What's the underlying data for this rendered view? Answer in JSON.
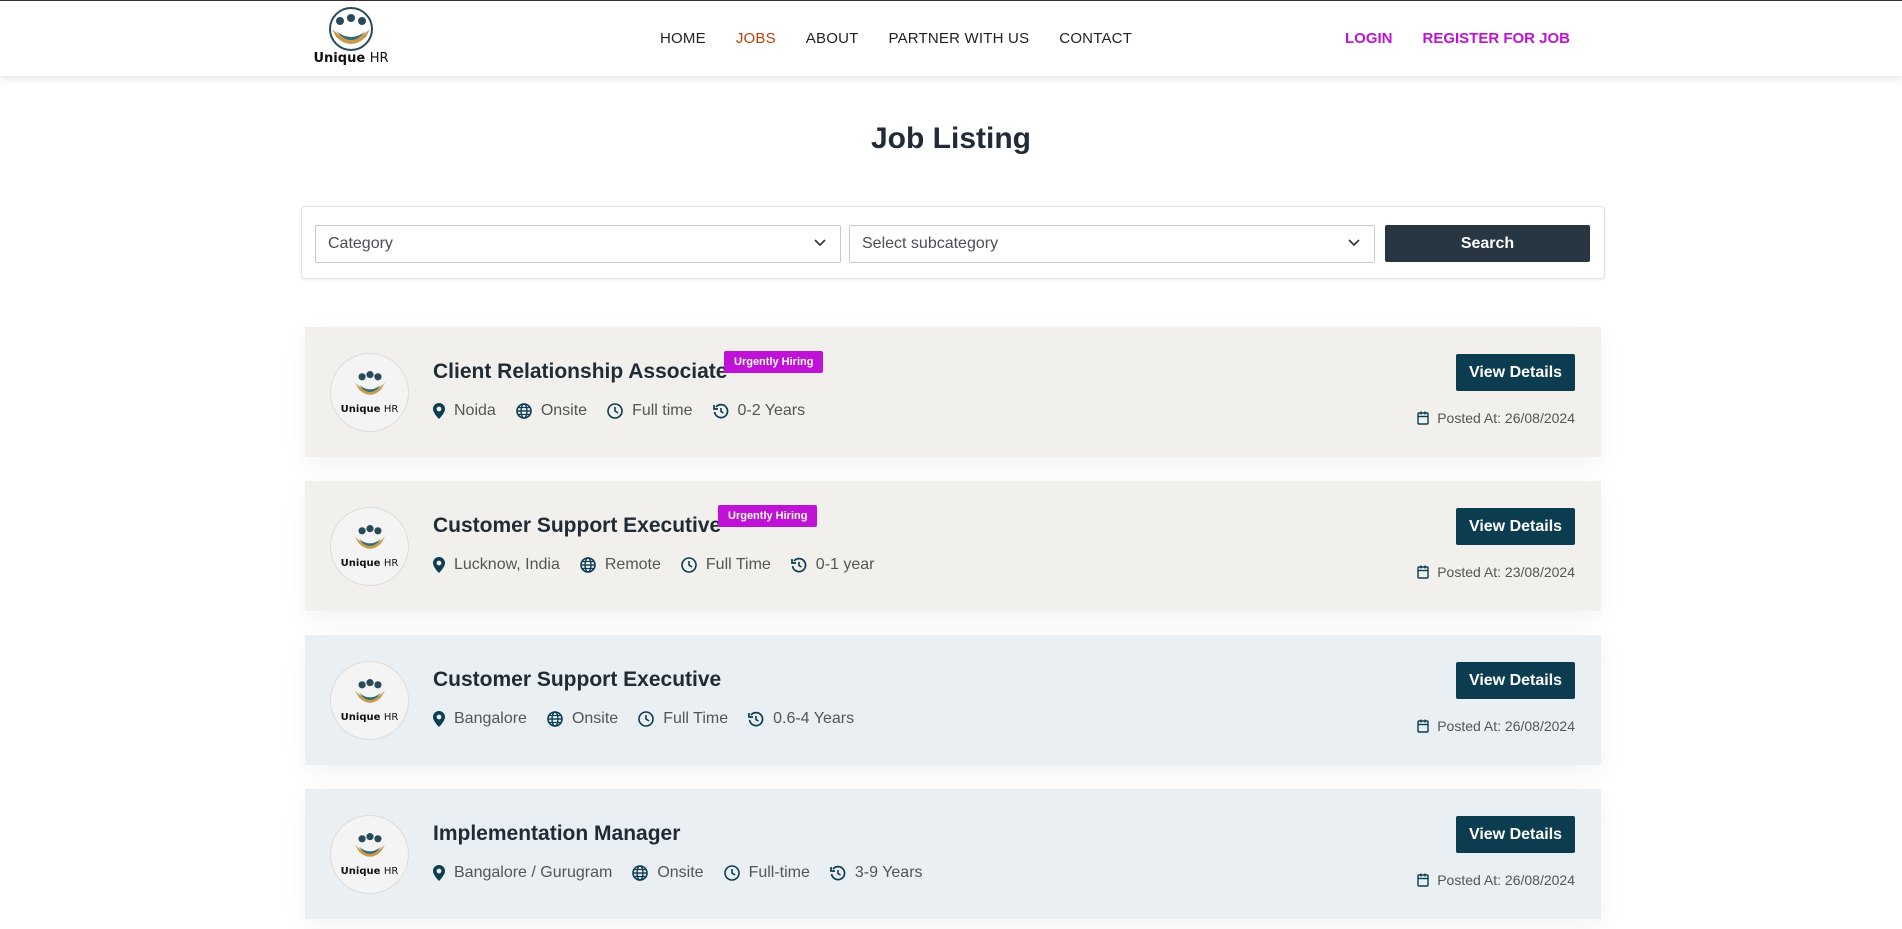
{
  "brand": {
    "name": "Unique",
    "suffix": "HR"
  },
  "nav": {
    "links": [
      {
        "label": "HOME",
        "active": false
      },
      {
        "label": "JOBS",
        "active": true
      },
      {
        "label": "ABOUT",
        "active": false
      },
      {
        "label": "PARTNER WITH US",
        "active": false
      },
      {
        "label": "CONTACT",
        "active": false
      }
    ],
    "login": "LOGIN",
    "register": "REGISTER FOR JOB"
  },
  "page": {
    "title": "Job Listing"
  },
  "filters": {
    "category": "Category",
    "subcategory": "Select subcategory",
    "search_label": "Search"
  },
  "jobs": [
    {
      "title": "Client Relationship Associate",
      "badge": "Urgently Hiring",
      "location": "Noida",
      "mode": "Onsite",
      "type": "Full time",
      "experience": "0-2 Years",
      "posted": "Posted At: 26/08/2024",
      "button": "View Details"
    },
    {
      "title": "Customer Support Executive",
      "badge": "Urgently Hiring",
      "location": "Lucknow, India",
      "mode": "Remote",
      "type": "Full Time",
      "experience": "0-1 year",
      "posted": "Posted At: 23/08/2024",
      "button": "View Details"
    },
    {
      "title": "Customer Support Executive",
      "badge": "",
      "location": "Bangalore",
      "mode": "Onsite",
      "type": "Full Time",
      "experience": "0.6-4 Years",
      "posted": "Posted At: 26/08/2024",
      "button": "View Details"
    },
    {
      "title": "Implementation Manager",
      "badge": "",
      "location": "Bangalore / Gurugram",
      "mode": "Onsite",
      "type": "Full-time",
      "experience": "3-9 Years",
      "posted": "Posted At: 26/08/2024",
      "button": "View Details"
    }
  ],
  "colors": {
    "accent": "#c012d6",
    "active_nav": "#c0400b",
    "button": "#0c3c50",
    "search_button": "#273640"
  }
}
